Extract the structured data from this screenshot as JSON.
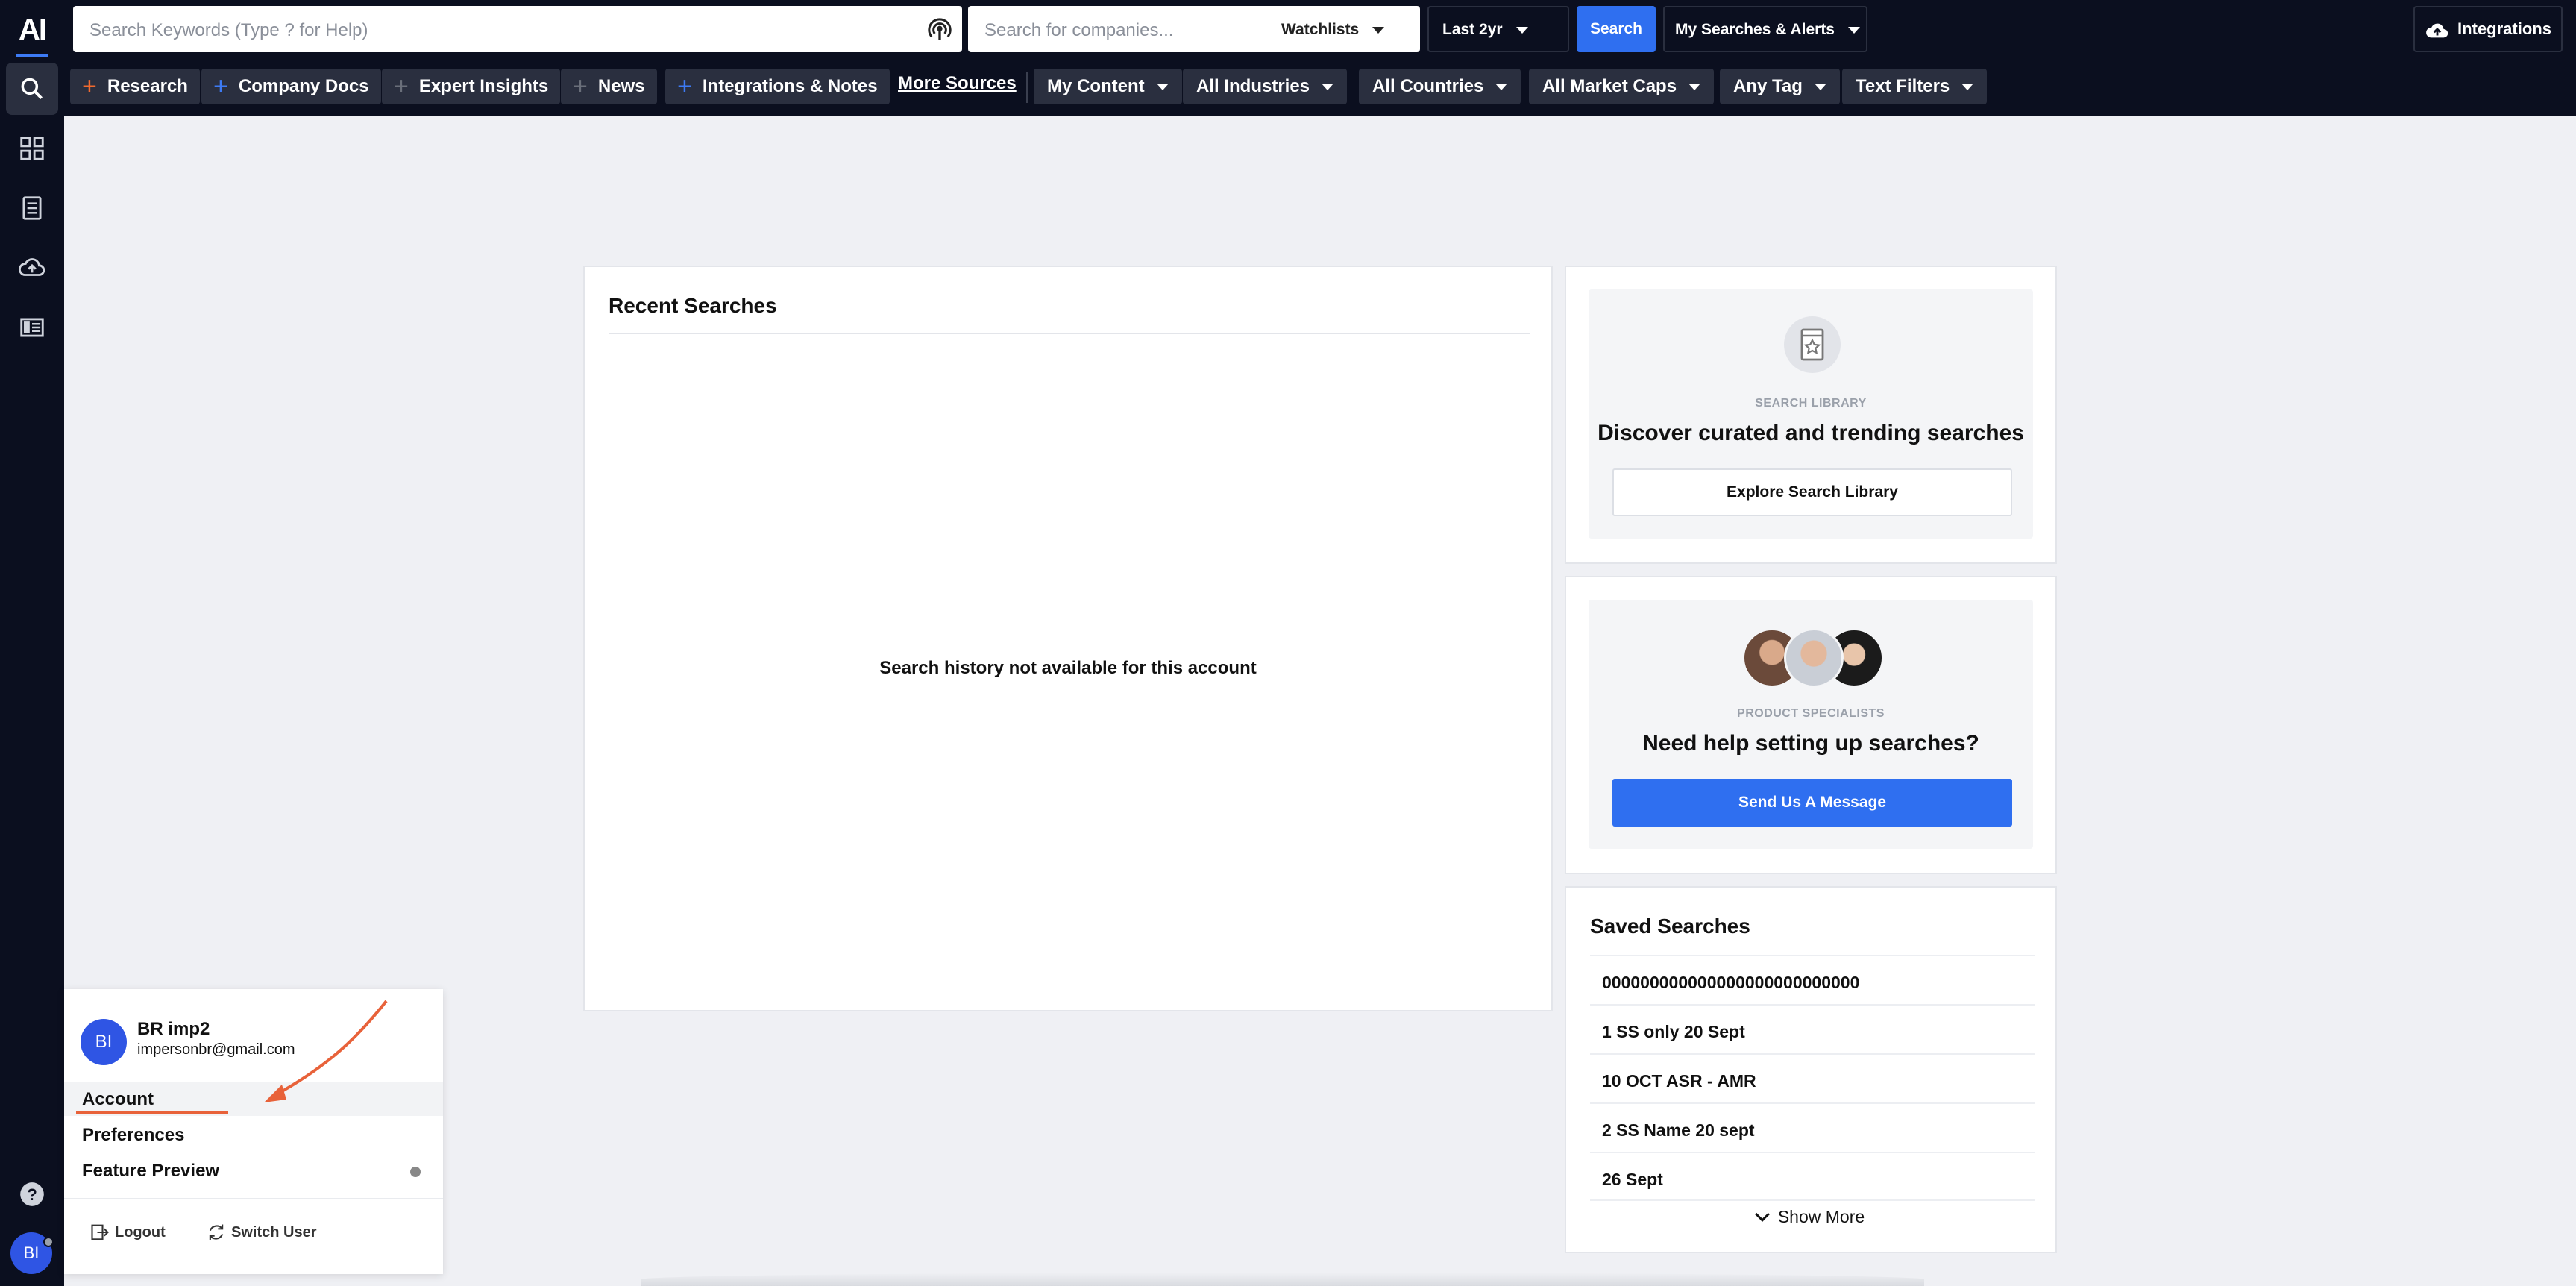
{
  "rail": {
    "logo": "AI"
  },
  "topbar": {
    "search_placeholder": "Search Keywords (Type ? for Help)",
    "company_placeholder": "Search for companies...",
    "watchlists_label": "Watchlists",
    "date_range": "Last 2yr",
    "search_label": "Search",
    "my_searches_label": "My Searches & Alerts",
    "integrations_label": "Integrations"
  },
  "sources": [
    {
      "label": "Research"
    },
    {
      "label": "Company Docs"
    },
    {
      "label": "Expert Insights"
    },
    {
      "label": "News"
    },
    {
      "label": "Integrations & Notes"
    }
  ],
  "more_sources": "More Sources",
  "filters": [
    {
      "label": "My Content"
    },
    {
      "label": "All Industries"
    },
    {
      "label": "All Countries"
    },
    {
      "label": "All Market Caps"
    },
    {
      "label": "Any Tag"
    },
    {
      "label": "Text Filters"
    }
  ],
  "recent": {
    "title": "Recent Searches",
    "empty_message": "Search history not available for this account"
  },
  "library": {
    "eyebrow": "SEARCH LIBRARY",
    "headline": "Discover curated and trending searches",
    "button": "Explore Search Library"
  },
  "specialists": {
    "eyebrow": "PRODUCT SPECIALISTS",
    "headline": "Need help setting up searches?",
    "button": "Send Us A Message"
  },
  "saved": {
    "title": "Saved Searches",
    "items": [
      "000000000000000000000000000",
      "1 SS only 20 Sept",
      "10 OCT ASR - AMR",
      "2 SS Name 20 sept",
      "26 Sept"
    ],
    "show_more": "Show More"
  },
  "account_menu": {
    "initials": "BI",
    "name": "BR imp2",
    "email": "impersonbr@gmail.com",
    "items": [
      "Account",
      "Preferences",
      "Feature Preview"
    ],
    "logout": "Logout",
    "switch_user": "Switch User"
  },
  "colors": {
    "nav_bg": "#0b0f1f",
    "accent_blue": "#2f6ff0",
    "annotation_orange": "#e8623a"
  }
}
